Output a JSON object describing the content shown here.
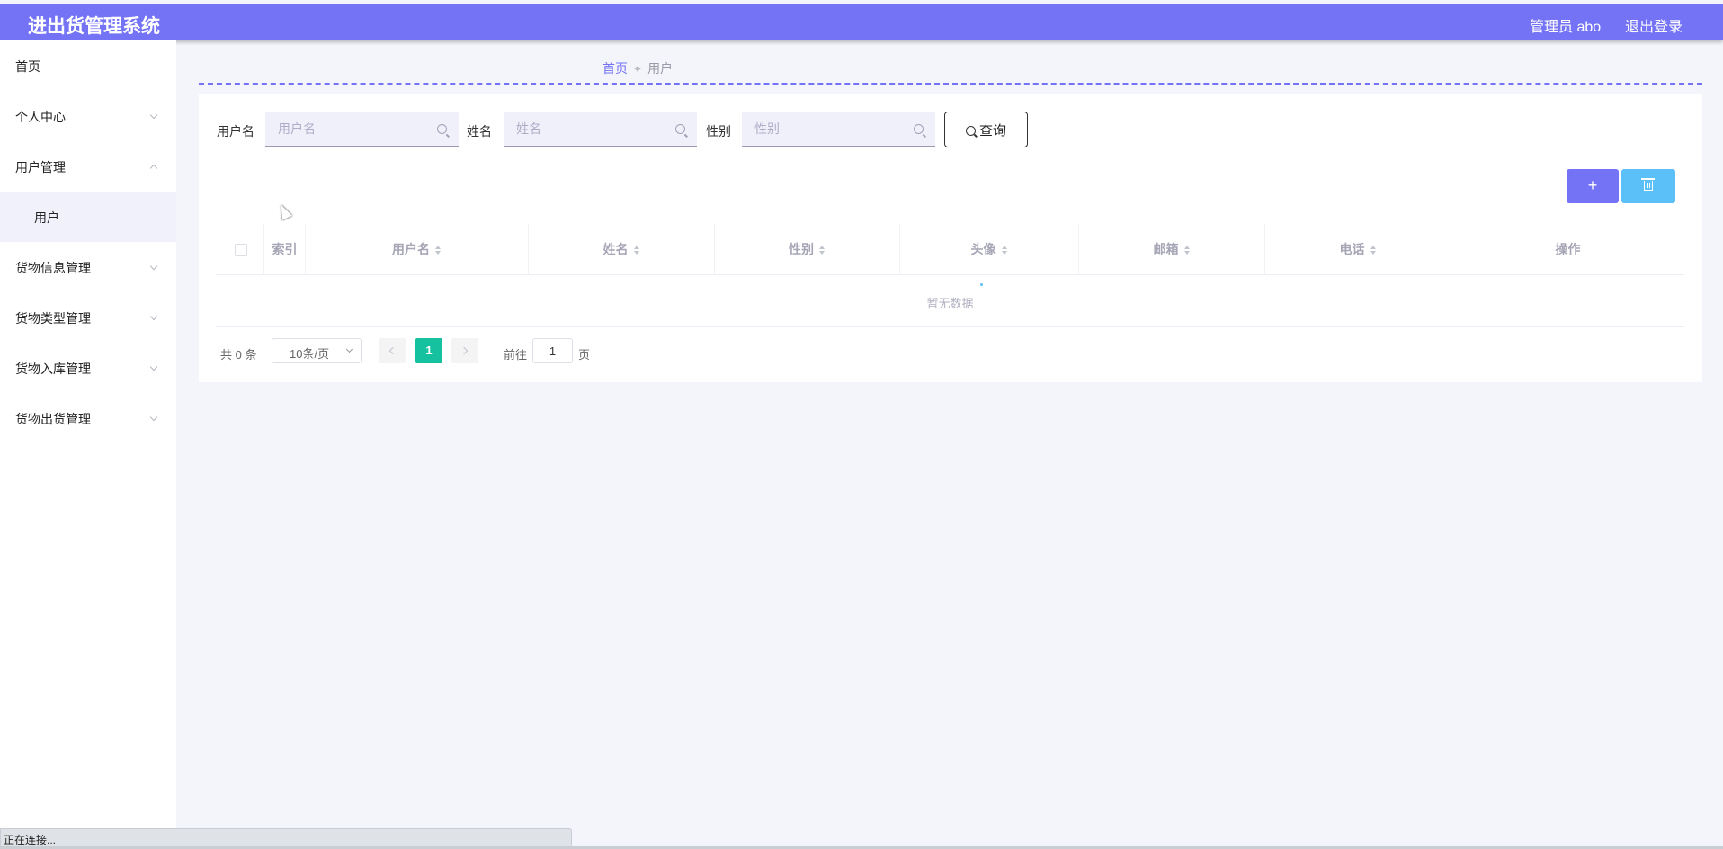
{
  "header": {
    "title": "进出货管理系统",
    "user_label": "管理员 abo",
    "logout_label": "退出登录"
  },
  "sidebar": {
    "items": [
      {
        "label": "首页"
      },
      {
        "label": "个人中心"
      },
      {
        "label": "用户管理"
      },
      {
        "label": "用户"
      },
      {
        "label": "货物信息管理"
      },
      {
        "label": "货物类型管理"
      },
      {
        "label": "货物入库管理"
      },
      {
        "label": "货物出货管理"
      }
    ]
  },
  "breadcrumb": {
    "home": "首页",
    "current": "用户"
  },
  "search": {
    "username_label": "用户名",
    "username_placeholder": "用户名",
    "name_label": "姓名",
    "name_placeholder": "姓名",
    "gender_label": "性别",
    "gender_placeholder": "性别",
    "query_label": "查询"
  },
  "actions": {
    "add_label": "+"
  },
  "table": {
    "columns": [
      "索引",
      "用户名",
      "姓名",
      "性别",
      "头像",
      "邮箱",
      "电话",
      "操作"
    ],
    "empty_text": "暂无数据"
  },
  "pagination": {
    "total_text": "共 0 条",
    "page_size": "10条/页",
    "current_page": "1",
    "goto_label": "前往",
    "goto_value": "1",
    "page_suffix": "页"
  },
  "status_bar": {
    "text": "正在连接..."
  },
  "colors": {
    "primary": "#7472f5",
    "info": "#5bc0f8",
    "success": "#16c1a0"
  }
}
